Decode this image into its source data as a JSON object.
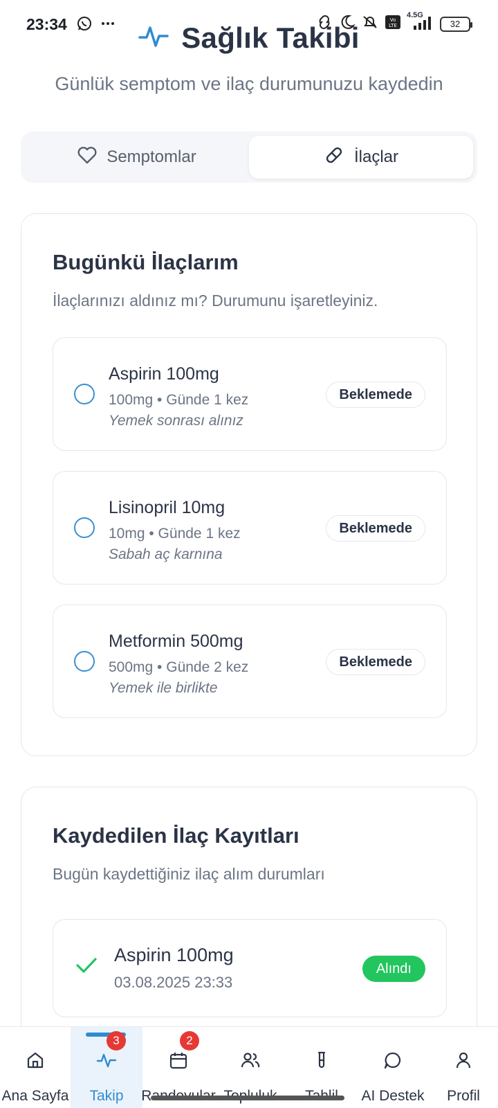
{
  "status_bar": {
    "time": "23:34",
    "network": "4.5G",
    "battery": "32",
    "icons": [
      "whatsapp-icon",
      "more-dots-icon",
      "link-icon",
      "moon-icon",
      "mute-icon",
      "volte-icon",
      "signal-icon",
      "battery-icon"
    ]
  },
  "header": {
    "title": "Sağlık Takibi",
    "subtitle": "Günlük semptom ve ilaç durumunuzu kaydedin",
    "icon": "activity-icon",
    "accent_color": "#2f8bd0"
  },
  "tabs": [
    {
      "label": "Semptomlar",
      "icon": "heart-icon",
      "active": false
    },
    {
      "label": "İlaçlar",
      "icon": "pill-icon",
      "active": true
    }
  ],
  "today_meds": {
    "title": "Bugünkü İlaçlarım",
    "description": "İlaçlarınızı aldınız mı? Durumunu işaretleyiniz.",
    "items": [
      {
        "name": "Aspirin 100mg",
        "dose": "100mg • Günde 1 kez",
        "note": "Yemek sonrası alınız",
        "status": "Beklemede"
      },
      {
        "name": "Lisinopril 10mg",
        "dose": "10mg • Günde 1 kez",
        "note": "Sabah aç karnına",
        "status": "Beklemede"
      },
      {
        "name": "Metformin 500mg",
        "dose": "500mg • Günde 2 kez",
        "note": "Yemek ile birlikte",
        "status": "Beklemede"
      }
    ]
  },
  "records": {
    "title": "Kaydedilen İlaç Kayıtları",
    "description": "Bugün kaydettiğiniz ilaç alım durumları",
    "items": [
      {
        "name": "Aspirin 100mg",
        "timestamp": "03.08.2025 23:33",
        "status": "Alındı",
        "status_color": "#22c55e"
      }
    ]
  },
  "bottom_nav": [
    {
      "label": "Ana Sayfa",
      "icon": "home-icon",
      "active": false,
      "badge": null
    },
    {
      "label": "Takip",
      "icon": "activity-icon",
      "active": true,
      "badge": "3"
    },
    {
      "label": "Randevular",
      "icon": "calendar-icon",
      "active": false,
      "badge": "2"
    },
    {
      "label": "Topluluk",
      "icon": "users-icon",
      "active": false,
      "badge": null
    },
    {
      "label": "Tahlil",
      "icon": "test-tube-icon",
      "active": false,
      "badge": null
    },
    {
      "label": "AI Destek",
      "icon": "chat-icon",
      "active": false,
      "badge": null
    },
    {
      "label": "Profil",
      "icon": "user-icon",
      "active": false,
      "badge": null
    }
  ]
}
